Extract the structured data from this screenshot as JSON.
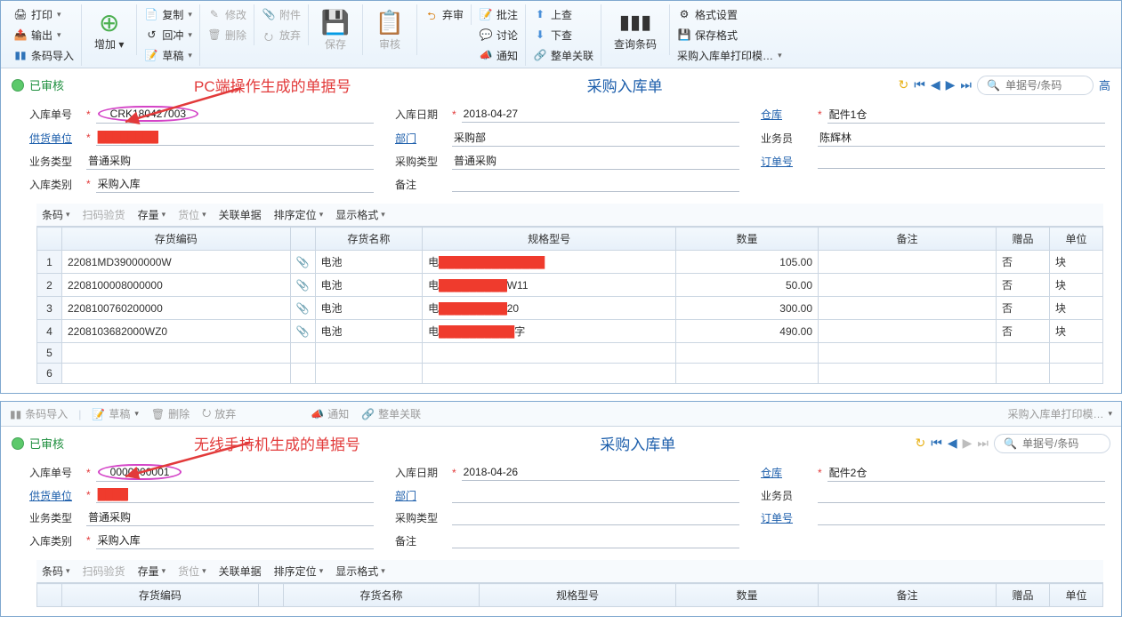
{
  "ribbon": {
    "print": "打印",
    "output": "输出",
    "barcode_import": "条码导入",
    "add": "增加",
    "copy": "复制",
    "hedge": "回冲",
    "draft": "草稿",
    "modify": "修改",
    "delete": "删除",
    "attach": "附件",
    "discard": "放弃",
    "save": "保存",
    "audit": "审核",
    "abandon": "弃审",
    "batch_notice": "批注",
    "discuss": "讨论",
    "notify": "通知",
    "up": "上查",
    "down": "下查",
    "whole_close": "整单关联",
    "query_barcode": "查询条码",
    "fmt_set": "格式设置",
    "fmt_save": "保存格式",
    "print_tpl": "采购入库单打印模…"
  },
  "status_approved": "已审核",
  "annotations": {
    "pc": "PC端操作生成的单据号",
    "wireless": "无线手持机生成的单据号"
  },
  "doc_title": "采购入库单",
  "search_placeholder": "单据号/条码",
  "labels": {
    "doc_no": "入库单号",
    "doc_date": "入库日期",
    "warehouse": "仓库",
    "supplier": "供货单位",
    "dept": "部门",
    "clerk": "业务员",
    "biz_type": "业务类型",
    "buy_type": "采购类型",
    "order_no": "订单号",
    "in_type": "入库类别",
    "remark": "备注"
  },
  "toolbar2": {
    "barcode": "条码",
    "scan_check": "扫码验货",
    "stock": "存量",
    "bin": "货位",
    "assoc": "关联单据",
    "sort": "排序定位",
    "disp": "显示格式"
  },
  "columns": {
    "code": "存货编码",
    "name": "存货名称",
    "spec": "规格型号",
    "qty": "数量",
    "remark": "备注",
    "gift": "赠品",
    "unit": "单位"
  },
  "doc1": {
    "doc_no": "CRK180427003",
    "doc_date": "2018-04-27",
    "warehouse": "配件1仓",
    "supplier_masked": "████████",
    "dept": "采购部",
    "clerk": "陈辉林",
    "biz_type": "普通采购",
    "buy_type": "普通采购",
    "order_no": "",
    "in_type": "采购入库",
    "remark": "",
    "rows": [
      {
        "code": "22081MD39000000W",
        "name": "电池",
        "spec_prefix": "电",
        "spec_mask": "██████████████",
        "qty": "105.00",
        "gift": "否",
        "unit": "块"
      },
      {
        "code": "2208100008000000",
        "name": "电池",
        "spec_prefix": "电",
        "spec_mask": "█████████",
        "spec_suffix": "W11",
        "qty": "50.00",
        "gift": "否",
        "unit": "块"
      },
      {
        "code": "2208100760200000",
        "name": "电池",
        "spec_prefix": "电",
        "spec_mask": "█████████",
        "spec_suffix": "20",
        "qty": "300.00",
        "gift": "否",
        "unit": "块"
      },
      {
        "code": "2208103682000WZ0",
        "name": "电池",
        "spec_prefix": "电",
        "spec_mask": "██████████",
        "spec_suffix": "字",
        "qty": "490.00",
        "gift": "否",
        "unit": "块"
      }
    ]
  },
  "doc2": {
    "doc_no": "0000000001",
    "doc_date": "2018-04-26",
    "warehouse": "配件2仓",
    "supplier_masked": "████",
    "dept": "",
    "clerk": "",
    "biz_type": "普通采购",
    "buy_type": "",
    "order_no": "",
    "in_type": "采购入库",
    "remark": ""
  }
}
